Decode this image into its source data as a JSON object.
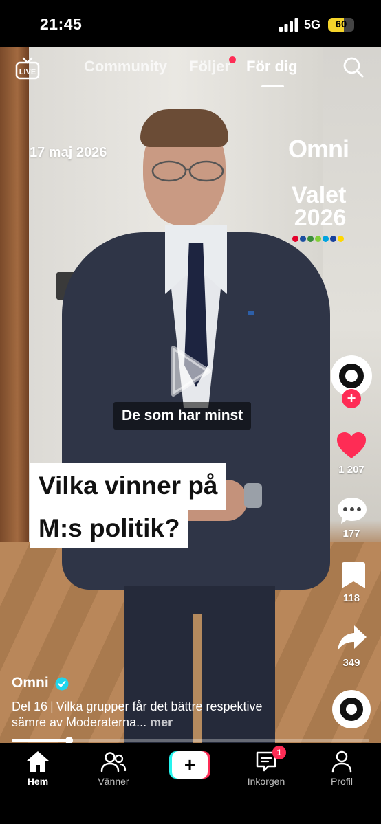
{
  "status_bar": {
    "time": "21:45",
    "network": "5G",
    "battery": "60",
    "battery_level": 0.6
  },
  "top_nav": {
    "tabs": [
      {
        "label": "Community"
      },
      {
        "label": "Följer"
      },
      {
        "label": "För dig"
      }
    ],
    "active_tab": "För dig",
    "left_icon": "live-tv-icon",
    "right_icon": "search-icon"
  },
  "video_overlay": {
    "date": "17 maj 2026",
    "brand": "Omni",
    "election_title_line1": "Valet",
    "election_title_line2": "2026",
    "party_colors": [
      "#e4002b",
      "#1b4ea0",
      "#3b8e3c",
      "#83cf39",
      "#00a3e0",
      "#18419d",
      "#ffd700"
    ],
    "subtitle": "De som har minst",
    "headline_line1": "Vilka vinner på",
    "headline_line2": "M:s politik?"
  },
  "actions": {
    "likes": "1 207",
    "comments": "177",
    "bookmarks": "118",
    "shares": "349"
  },
  "caption": {
    "author": "Omni",
    "part": "Del 16",
    "text": "Vilka grupper får det bättre respektive sämre av Moderaterna...",
    "more": "mer"
  },
  "playback": {
    "progress": 0.16
  },
  "bottom_nav": {
    "home": "Hem",
    "friends": "Vänner",
    "create": "+",
    "inbox": "Inkorgen",
    "inbox_badge": "1",
    "profile": "Profil"
  },
  "colors": {
    "accent": "#fe2c55",
    "cyan": "#25f4ee",
    "verified": "#20d5ec"
  }
}
